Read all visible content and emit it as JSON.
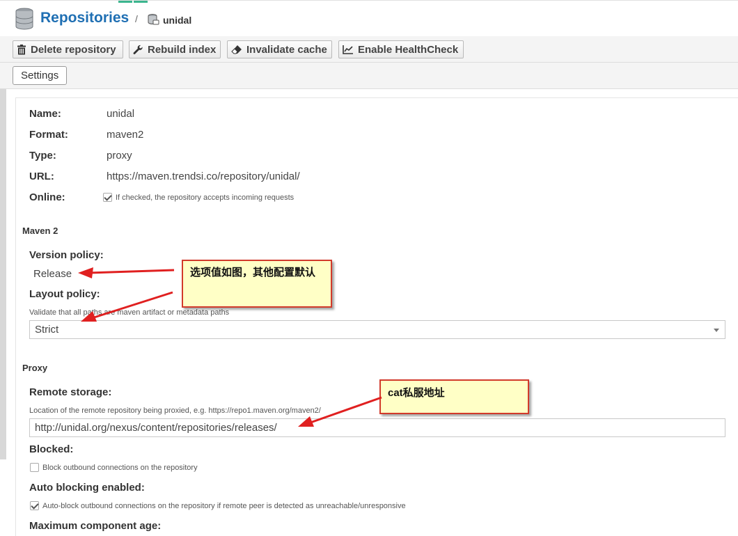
{
  "header": {
    "title": "Repositories",
    "separator": "/",
    "crumb": "unidal"
  },
  "toolbar": {
    "delete_label": "Delete repository",
    "rebuild_label": "Rebuild index",
    "invalidate_label": "Invalidate cache",
    "healthcheck_label": "Enable HealthCheck"
  },
  "tabs": {
    "settings_label": "Settings"
  },
  "details": {
    "name_label": "Name:",
    "name_value": "unidal",
    "format_label": "Format:",
    "format_value": "maven2",
    "type_label": "Type:",
    "type_value": "proxy",
    "url_label": "URL:",
    "url_value": "https://maven.trendsi.co/repository/unidal/",
    "online_label": "Online:",
    "online_help": "If checked, the repository accepts incoming requests",
    "online_checked": true
  },
  "maven": {
    "section": "Maven 2",
    "version_label": "Version policy:",
    "version_value": "Release",
    "layout_label": "Layout policy:",
    "layout_help": "Validate that all paths are maven artifact or metadata paths",
    "layout_value": "Strict"
  },
  "proxy": {
    "section": "Proxy",
    "remote_label": "Remote storage:",
    "remote_help": "Location of the remote repository being proxied, e.g. https://repo1.maven.org/maven2/",
    "remote_value": "http://unidal.org/nexus/content/repositories/releases/",
    "blocked_label": "Blocked:",
    "blocked_help": "Block outbound connections on the repository",
    "blocked_checked": false,
    "auto_label": "Auto blocking enabled:",
    "auto_help": "Auto-block outbound connections on the repository if remote peer is detected as unreachable/unresponsive",
    "auto_checked": true,
    "maxage_label": "Maximum component age:"
  },
  "annotations": {
    "note1": "选项值如图，其他配置默认",
    "note2": "cat私服地址",
    "arrow_color": "#e02020"
  },
  "colors": {
    "brand": "#1f6fb3",
    "note_bg": "#ffffc6",
    "note_border": "#d23a2b"
  }
}
